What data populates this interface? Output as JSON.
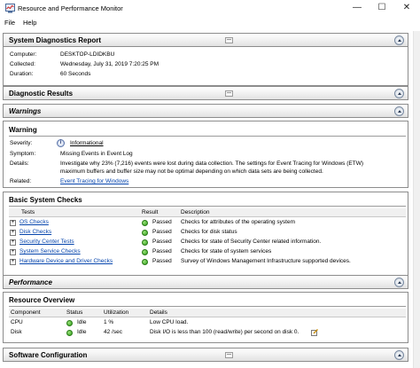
{
  "window": {
    "title": "Resource and Performance Monitor",
    "minimize": "—",
    "maximize": "☐",
    "close": "✕"
  },
  "menu": {
    "file": "File",
    "help": "Help"
  },
  "report": {
    "header": "System Diagnostics Report",
    "computer_label": "Computer:",
    "computer_value": "DESKTOP-LDIDKBU",
    "collected_label": "Collected:",
    "collected_value": "Wednesday, July 31, 2019 7:20:25 PM",
    "duration_label": "Duration:",
    "duration_value": "60 Seconds"
  },
  "diagnostic_results": {
    "header": "Diagnostic Results"
  },
  "warnings": {
    "header": "Warnings",
    "panel_title": "Warning",
    "severity_label": "Severity:",
    "severity_value": "Informational",
    "symptom_label": "Symptom:",
    "symptom_value": "Missing Events in Event Log",
    "details_label": "Details:",
    "details_line1": "Investigate why 23% (7,216) events were lost during data collection. The settings for Event Tracing for Windows (ETW)",
    "details_line2": "maximum buffers and buffer size may not be optimal depending on which data sets are being collected.",
    "related_label": "Related:",
    "related_value": "Event Tracing for Windows"
  },
  "basic_checks": {
    "title": "Basic System Checks",
    "columns": [
      "Tests",
      "Result",
      "Description"
    ],
    "rows": [
      {
        "test": "OS Checks",
        "result": "Passed",
        "description": "Checks for attributes of the operating system"
      },
      {
        "test": "Disk Checks",
        "result": "Passed",
        "description": "Checks for disk status"
      },
      {
        "test": "Security Center Tests",
        "result": "Passed",
        "description": "Checks for state of Security Center related information."
      },
      {
        "test": "System Service Checks",
        "result": "Passed",
        "description": "Checks for state of system services"
      },
      {
        "test": "Hardware Device and Driver Checks",
        "result": "Passed",
        "description": "Survey of Windows Management Infrastructure supported devices."
      }
    ]
  },
  "performance": {
    "header": "Performance",
    "resource_title": "Resource Overview",
    "columns": [
      "Component",
      "Status",
      "Utilization",
      "Details"
    ],
    "rows": [
      {
        "component": "CPU",
        "status": "Idle",
        "utilization": "1 %",
        "details": "Low CPU load."
      },
      {
        "component": "Disk",
        "status": "Idle",
        "utilization": "42 /sec",
        "details": "Disk I/O is less than 100 (read/write) per second on disk 0."
      }
    ]
  },
  "software": {
    "header": "Software Configuration"
  },
  "icons": {
    "app": "monitor-icon",
    "info": "info-icon",
    "status_ok": "green-status-icon",
    "expand": "plus-icon",
    "collapse": "chevron-up-icon",
    "expand_section": "chevron-down-icon",
    "edit": "edit-icon"
  },
  "colors": {
    "link": "#0645ad",
    "status_ok": "#2e9e1a",
    "header_border": "#8c8c8c"
  }
}
